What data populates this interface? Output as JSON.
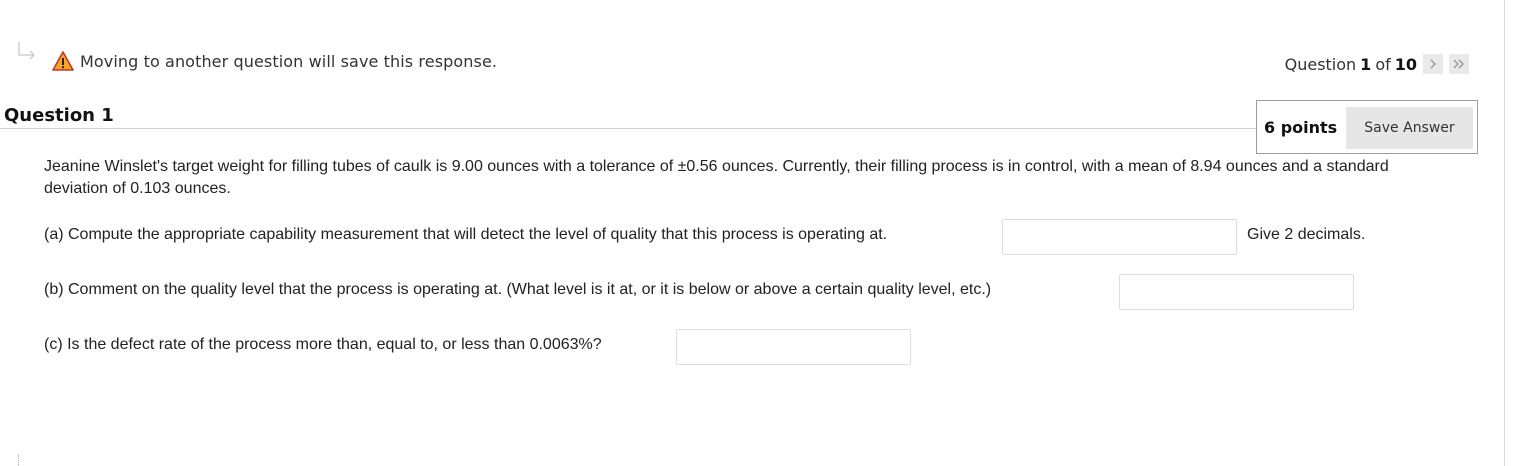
{
  "warning": {
    "icon": "warning-icon",
    "text": "Moving to another question will save this response."
  },
  "question_nav": {
    "prefix": "Question",
    "current": "1",
    "of_label": "of",
    "total": "10",
    "next_icon": "chevron-right-icon",
    "last_icon": "double-chevron-right-icon"
  },
  "question": {
    "title": "Question 1",
    "points": "6 points",
    "save_label": "Save Answer",
    "text": "Jeanine Winslet's target weight for filling tubes of caulk is 9.00 ounces with a tolerance of ±0.56 ounces. Currently, their filling process is in control, with a mean of 8.94 ounces and a standard deviation of 0.103 ounces.",
    "parts": [
      {
        "label": "(a) Compute the appropriate capability measurement that will detect the level of quality that this process is operating at.",
        "value": "",
        "hint": "Give 2 decimals."
      },
      {
        "label": "(b) Comment on the quality level that the process is operating at.  (What level is it at, or it is below or above a certain quality level, etc.)",
        "value": ""
      },
      {
        "label": "(c) Is the defect rate of the process more than, equal to, or less than 0.0063%?",
        "value": ""
      }
    ]
  },
  "colors": {
    "warning_fill": "#f5a623",
    "warning_border": "#c0392b",
    "save_button_bg": "#e6e6e6"
  }
}
